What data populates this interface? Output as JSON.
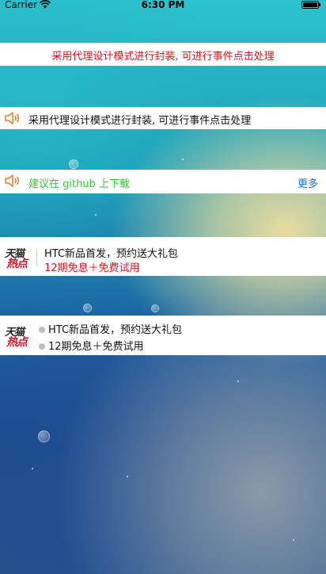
{
  "status_bar": {
    "carrier": "Carrier",
    "time": "6:30 PM"
  },
  "banner_centered": {
    "text": "采用代理设计模式进行封装, 可进行事件点击处理",
    "color": "#e0121e"
  },
  "banner_speaker": {
    "icon": "speaker-icon",
    "text": "采用代理设计模式进行封装, 可进行事件点击处理"
  },
  "banner_speaker_more": {
    "icon": "speaker-icon",
    "text": "建议在 github 上下载",
    "more_label": "更多",
    "text_color": "#2ecb2e",
    "more_color": "#1e6fd9"
  },
  "tmall_banner_1": {
    "logo_top": "天猫",
    "logo_bottom": "热点",
    "line1": "HTC新品首发，预约送大礼包",
    "line2": "12期免息＋免费试用"
  },
  "tmall_banner_2": {
    "logo_top": "天猫",
    "logo_bottom": "热点",
    "items": [
      "HTC新品首发，预约送大礼包",
      "12期免息＋免费试用"
    ]
  }
}
